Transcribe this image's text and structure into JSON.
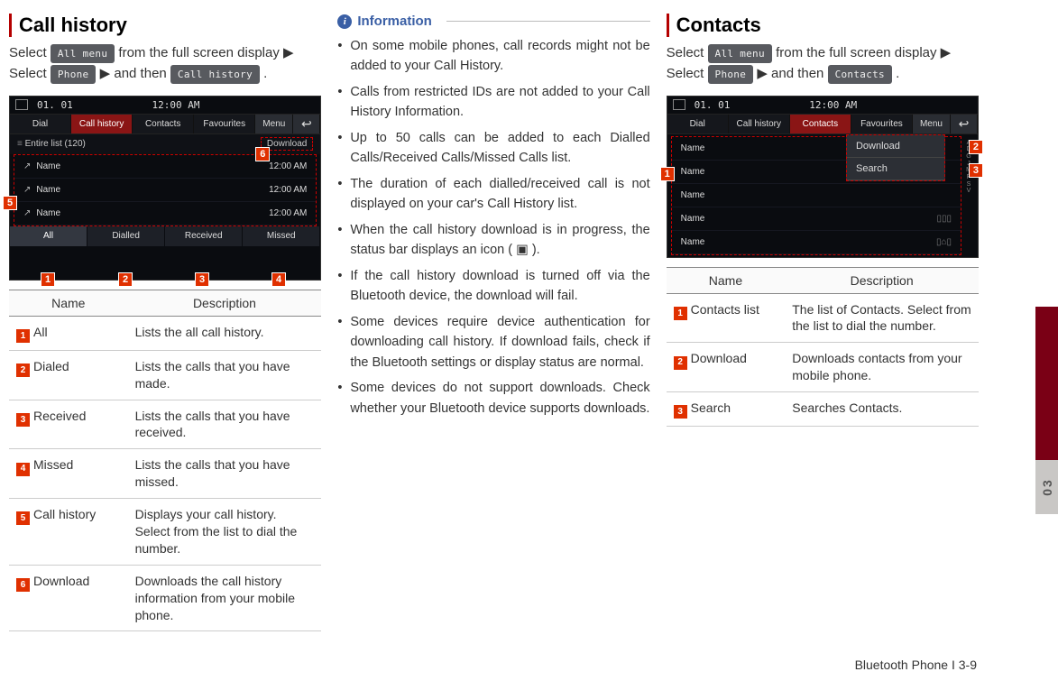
{
  "left": {
    "title": "Call history",
    "instr_prefix": "Select ",
    "btn_allmenu": "All menu",
    "instr_mid": " from the full screen display ▶ Select ",
    "btn_phone": "Phone",
    "instr_mid2": " ▶ and then ",
    "btn_callhist": "Call history",
    "instr_end": ".",
    "shot": {
      "date": "01. 01",
      "time": "12:00 AM",
      "tabs": [
        "Dial",
        "Call history",
        "Contacts",
        "Favourites"
      ],
      "menu": "Menu",
      "back": "↩",
      "sub_left": "Entire list (120)",
      "sub_right": "Download",
      "row_name": "Name",
      "row_time": "12:00 AM",
      "bottom": [
        "All",
        "Dialled",
        "Received",
        "Missed"
      ]
    },
    "table": {
      "h1": "Name",
      "h2": "Description",
      "rows": [
        {
          "n": "1",
          "name": "All",
          "desc": "Lists the all call history."
        },
        {
          "n": "2",
          "name": "Dialed",
          "desc": "Lists the calls that you have made."
        },
        {
          "n": "3",
          "name": "Received",
          "desc": "Lists the calls that you have received."
        },
        {
          "n": "4",
          "name": "Missed",
          "desc": "Lists the calls that you have missed."
        },
        {
          "n": "5",
          "name": "Call history",
          "desc": "Displays your call history. Select from the list to dial the number."
        },
        {
          "n": "6",
          "name": "Download",
          "desc": "Downloads the call history information from your mobile phone."
        }
      ]
    }
  },
  "mid": {
    "heading": "Information",
    "items": [
      "On some mobile phones, call records might not be added to your Call History.",
      "Calls from restricted IDs are not added to your Call History Information.",
      "Up to 50 calls can be added to each Dialled Calls/Received Calls/Missed Calls list.",
      "The duration of each dialled/received call is not displayed on your car's Call History list.",
      "When the call history download is in progress, the status bar displays an icon ( ▣ ).",
      "If the call history download is turned off via the Bluetooth device, the download will fail.",
      "Some devices require device authentication for downloading call history. If download fails, check if the Bluetooth settings or display status are normal.",
      "Some devices do not support downloads. Check whether your Bluetooth device supports downloads."
    ]
  },
  "right": {
    "title": "Contacts",
    "instr_prefix": "Select ",
    "btn_allmenu": "All menu",
    "instr_mid": " from the full screen display ▶ Select ",
    "btn_phone": "Phone",
    "instr_mid2": " ▶ and then ",
    "btn_contacts": "Contacts",
    "instr_end": ".",
    "shot": {
      "date": "01. 01",
      "time": "12:00 AM",
      "tabs": [
        "Dial",
        "Call history",
        "Contacts",
        "Favourites"
      ],
      "menu": "Menu",
      "pop": [
        "Download",
        "Search"
      ],
      "row": "Name",
      "alpha": "A D G J M P S V"
    },
    "table": {
      "h1": "Name",
      "h2": "Description",
      "rows": [
        {
          "n": "1",
          "name": "Contacts list",
          "desc": "The list of Contacts. Select from the list to dial the number."
        },
        {
          "n": "2",
          "name": "Download",
          "desc": "Downloads contacts from your mobile phone."
        },
        {
          "n": "3",
          "name": "Search",
          "desc": "Searches Contacts."
        }
      ]
    }
  },
  "sideTab": "03",
  "footer": "Bluetooth Phone I 3-9"
}
